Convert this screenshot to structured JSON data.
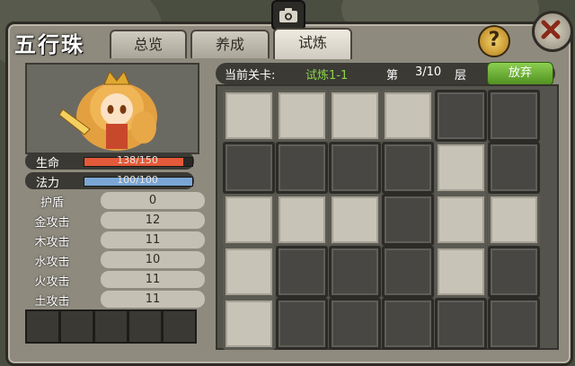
{
  "header": {
    "title": "五行珠",
    "tabs": [
      {
        "label": "总览",
        "active": false
      },
      {
        "label": "养成",
        "active": false
      },
      {
        "label": "试炼",
        "active": true
      }
    ],
    "help_label": "?"
  },
  "stats": {
    "hp": {
      "label": "生命",
      "text": "138/150",
      "ratio": 0.92,
      "color": "#e35a3a"
    },
    "mp": {
      "label": "法力",
      "text": "100/100",
      "ratio": 1.0,
      "color": "#7aa6d6"
    }
  },
  "attributes": [
    {
      "label": "护盾",
      "value": "0"
    },
    {
      "label": "金攻击",
      "value": "12"
    },
    {
      "label": "木攻击",
      "value": "11"
    },
    {
      "label": "水攻击",
      "value": "10"
    },
    {
      "label": "火攻击",
      "value": "11"
    },
    {
      "label": "土攻击",
      "value": "11"
    }
  ],
  "level": {
    "label": "当前关卡:",
    "name": "试炼1-1",
    "prefix": "第",
    "progress": "3/10",
    "suffix": "层",
    "abandon": "放弃"
  },
  "grid": [
    [
      "light",
      "light",
      "light",
      "light",
      "dark",
      "dark"
    ],
    [
      "dark",
      "dark",
      "dark",
      "dark",
      "light",
      "dark"
    ],
    [
      "light",
      "light",
      "light",
      "dark",
      "light",
      "light"
    ],
    [
      "light",
      "dark",
      "dark",
      "dark",
      "light",
      "dark"
    ],
    [
      "light",
      "dark",
      "dark",
      "dark",
      "dark",
      "dark"
    ]
  ],
  "colors": {
    "accent_green": "#8bd64a",
    "tile_light": "#c7c3b6",
    "tile_dark": "#484743"
  }
}
